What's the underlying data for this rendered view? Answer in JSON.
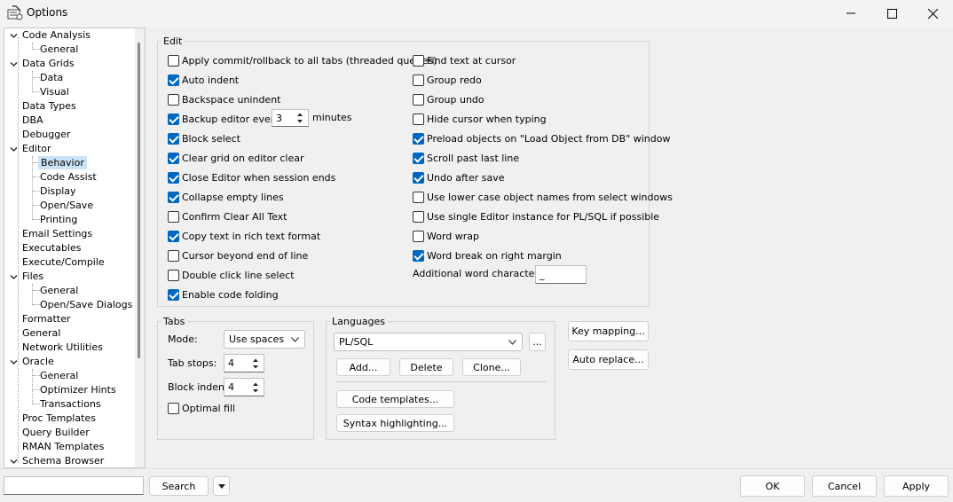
{
  "window": {
    "title": "Options"
  },
  "tree": {
    "items": [
      {
        "label": "Code Analysis"
      },
      {
        "label": "General"
      },
      {
        "label": "Data Grids"
      },
      {
        "label": "Data"
      },
      {
        "label": "Visual"
      },
      {
        "label": "Data Types"
      },
      {
        "label": "DBA"
      },
      {
        "label": "Debugger"
      },
      {
        "label": "Editor"
      },
      {
        "label": "Behavior"
      },
      {
        "label": "Code Assist"
      },
      {
        "label": "Display"
      },
      {
        "label": "Open/Save"
      },
      {
        "label": "Printing"
      },
      {
        "label": "Email Settings"
      },
      {
        "label": "Executables"
      },
      {
        "label": "Execute/Compile"
      },
      {
        "label": "Files"
      },
      {
        "label": "General"
      },
      {
        "label": "Open/Save Dialogs"
      },
      {
        "label": "Formatter"
      },
      {
        "label": "General"
      },
      {
        "label": "Network Utilities"
      },
      {
        "label": "Oracle"
      },
      {
        "label": "General"
      },
      {
        "label": "Optimizer Hints"
      },
      {
        "label": "Transactions"
      },
      {
        "label": "Proc Templates"
      },
      {
        "label": "Query Builder"
      },
      {
        "label": "RMAN Templates"
      },
      {
        "label": "Schema Browser"
      }
    ],
    "selected": "Behavior"
  },
  "edit": {
    "title": "Edit",
    "left": [
      {
        "label": "Apply commit/rollback to all tabs (threaded queries)",
        "checked": false
      },
      {
        "label": "Auto indent",
        "checked": true
      },
      {
        "label": "Backspace unindent",
        "checked": false
      },
      {
        "label": "Backup editor every",
        "checked": true
      },
      {
        "label": "Block select",
        "checked": true
      },
      {
        "label": "Clear grid on editor clear",
        "checked": true
      },
      {
        "label": "Close Editor when session ends",
        "checked": true
      },
      {
        "label": "Collapse empty lines",
        "checked": true
      },
      {
        "label": "Confirm Clear All Text",
        "checked": false
      },
      {
        "label": "Copy text in rich text format",
        "checked": true
      },
      {
        "label": "Cursor beyond end of line",
        "checked": false
      },
      {
        "label": "Double click line select",
        "checked": false
      },
      {
        "label": "Enable code folding",
        "checked": true
      }
    ],
    "right": [
      {
        "label": "Find text at cursor",
        "checked": false
      },
      {
        "label": "Group redo",
        "checked": false
      },
      {
        "label": "Group undo",
        "checked": false
      },
      {
        "label": "Hide cursor when typing",
        "checked": false
      },
      {
        "label": "Preload objects on \"Load Object from DB\" window",
        "checked": true
      },
      {
        "label": "Scroll past last line",
        "checked": true
      },
      {
        "label": "Undo after save",
        "checked": true
      },
      {
        "label": "Use lower case object names from select windows",
        "checked": false
      },
      {
        "label": "Use single Editor instance for PL/SQL if possible",
        "checked": false
      },
      {
        "label": "Word wrap",
        "checked": false
      },
      {
        "label": "Word break on right margin",
        "checked": true
      }
    ],
    "backup_minutes": "3",
    "minutes_label": "minutes",
    "additional_word_chars_label": "Additional word characters:",
    "additional_word_chars_value": "_"
  },
  "tabs": {
    "title": "Tabs",
    "mode_label": "Mode:",
    "mode_value": "Use spaces",
    "tab_stops_label": "Tab stops:",
    "tab_stops_value": "4",
    "block_indent_label": "Block indent:",
    "block_indent_value": "4",
    "optimal_fill_label": "Optimal fill",
    "optimal_fill_checked": false
  },
  "languages": {
    "title": "Languages",
    "selected": "PL/SQL",
    "browse_label": "...",
    "add_label": "Add...",
    "delete_label": "Delete",
    "clone_label": "Clone...",
    "code_templates_label": "Code templates...",
    "syntax_highlighting_label": "Syntax highlighting..."
  },
  "side_buttons": {
    "key_mapping": "Key mapping...",
    "auto_replace": "Auto replace..."
  },
  "footer": {
    "search_value": "",
    "search_label": "Search",
    "ok_label": "OK",
    "cancel_label": "Cancel",
    "apply_label": "Apply"
  },
  "colors": {
    "accent": "#0067c0",
    "selection": "#cce4f7",
    "background": "#f0f0f0"
  }
}
